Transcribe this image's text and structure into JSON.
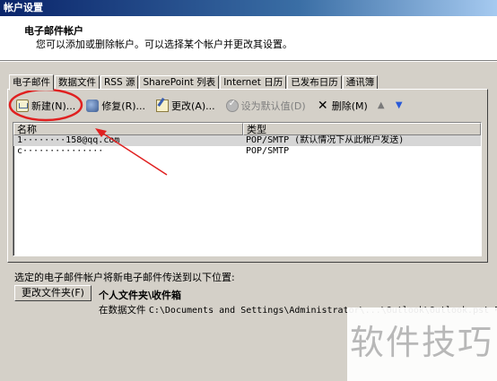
{
  "window": {
    "title": "帐户设置"
  },
  "header": {
    "title": "电子邮件帐户",
    "description": "您可以添加或删除帐户。可以选择某个帐户并更改其设置。"
  },
  "tabs": [
    {
      "label": "电子邮件",
      "active": true
    },
    {
      "label": "数据文件"
    },
    {
      "label": "RSS 源"
    },
    {
      "label": "SharePoint 列表"
    },
    {
      "label": "Internet 日历"
    },
    {
      "label": "已发布日历"
    },
    {
      "label": "通讯簿"
    }
  ],
  "toolbar": {
    "new_label": "新建(N)...",
    "repair_label": "修复(R)...",
    "change_label": "更改(A)...",
    "default_label": "设为默认值(D)",
    "delete_label": "删除(M)"
  },
  "list": {
    "columns": [
      "名称",
      "类型"
    ],
    "rows": [
      {
        "name": "1········158@qq.com",
        "type": "POP/SMTP (默认情况下从此帐户发送)"
      },
      {
        "name": "c···············",
        "type": "POP/SMTP"
      }
    ]
  },
  "delivery": {
    "label": "选定的电子邮件帐户将新电子邮件传送到以下位置:",
    "change_folder_label": "更改文件夹(F)",
    "folder_path": "个人文件夹\\收件箱",
    "data_file_prefix": "在数据文件",
    "data_file_path": "C:\\Documents and Settings\\Administrator\\...\\Outlook\\Outlook.pst 中"
  },
  "watermark": {
    "text": "软件技巧"
  },
  "colors": {
    "annotation_red": "#e02020",
    "titlebar": "#0a246a"
  }
}
